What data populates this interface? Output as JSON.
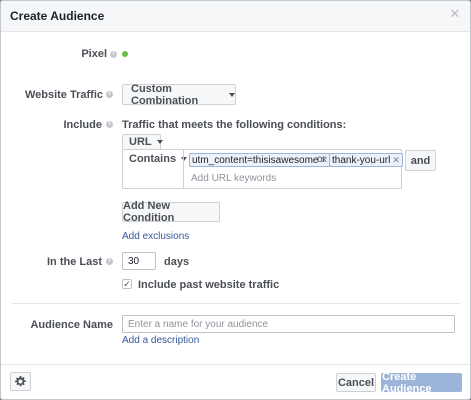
{
  "dialog": {
    "title": "Create Audience",
    "close_icon": "close-icon"
  },
  "pixel": {
    "label": "Pixel",
    "status_color": "#6bbd49"
  },
  "website_traffic": {
    "label": "Website Traffic",
    "selected": "Custom Combination"
  },
  "include": {
    "label": "Include",
    "heading": "Traffic that meets the following conditions:",
    "rule_field": "URL",
    "operator": "Contains",
    "tokens": [
      "utm_content=thisisawesome",
      "thank-you-url"
    ],
    "joiner": "or",
    "keyword_placeholder": "Add URL keywords",
    "and_label": "and",
    "add_condition_label": "Add New Condition",
    "add_exclusions_label": "Add exclusions"
  },
  "in_the_last": {
    "label": "In the Last",
    "value": "30",
    "unit": "days",
    "include_past_label": "Include past website traffic",
    "include_past_checked": true
  },
  "audience_name": {
    "label": "Audience Name",
    "placeholder": "Enter a name for your audience",
    "add_description_label": "Add a description"
  },
  "footer": {
    "settings_icon": "gear-icon",
    "cancel_label": "Cancel",
    "create_label": "Create Audience"
  },
  "colors": {
    "primary": "#4267b2",
    "primary_disabled": "#9cb4d8",
    "link": "#365899"
  }
}
